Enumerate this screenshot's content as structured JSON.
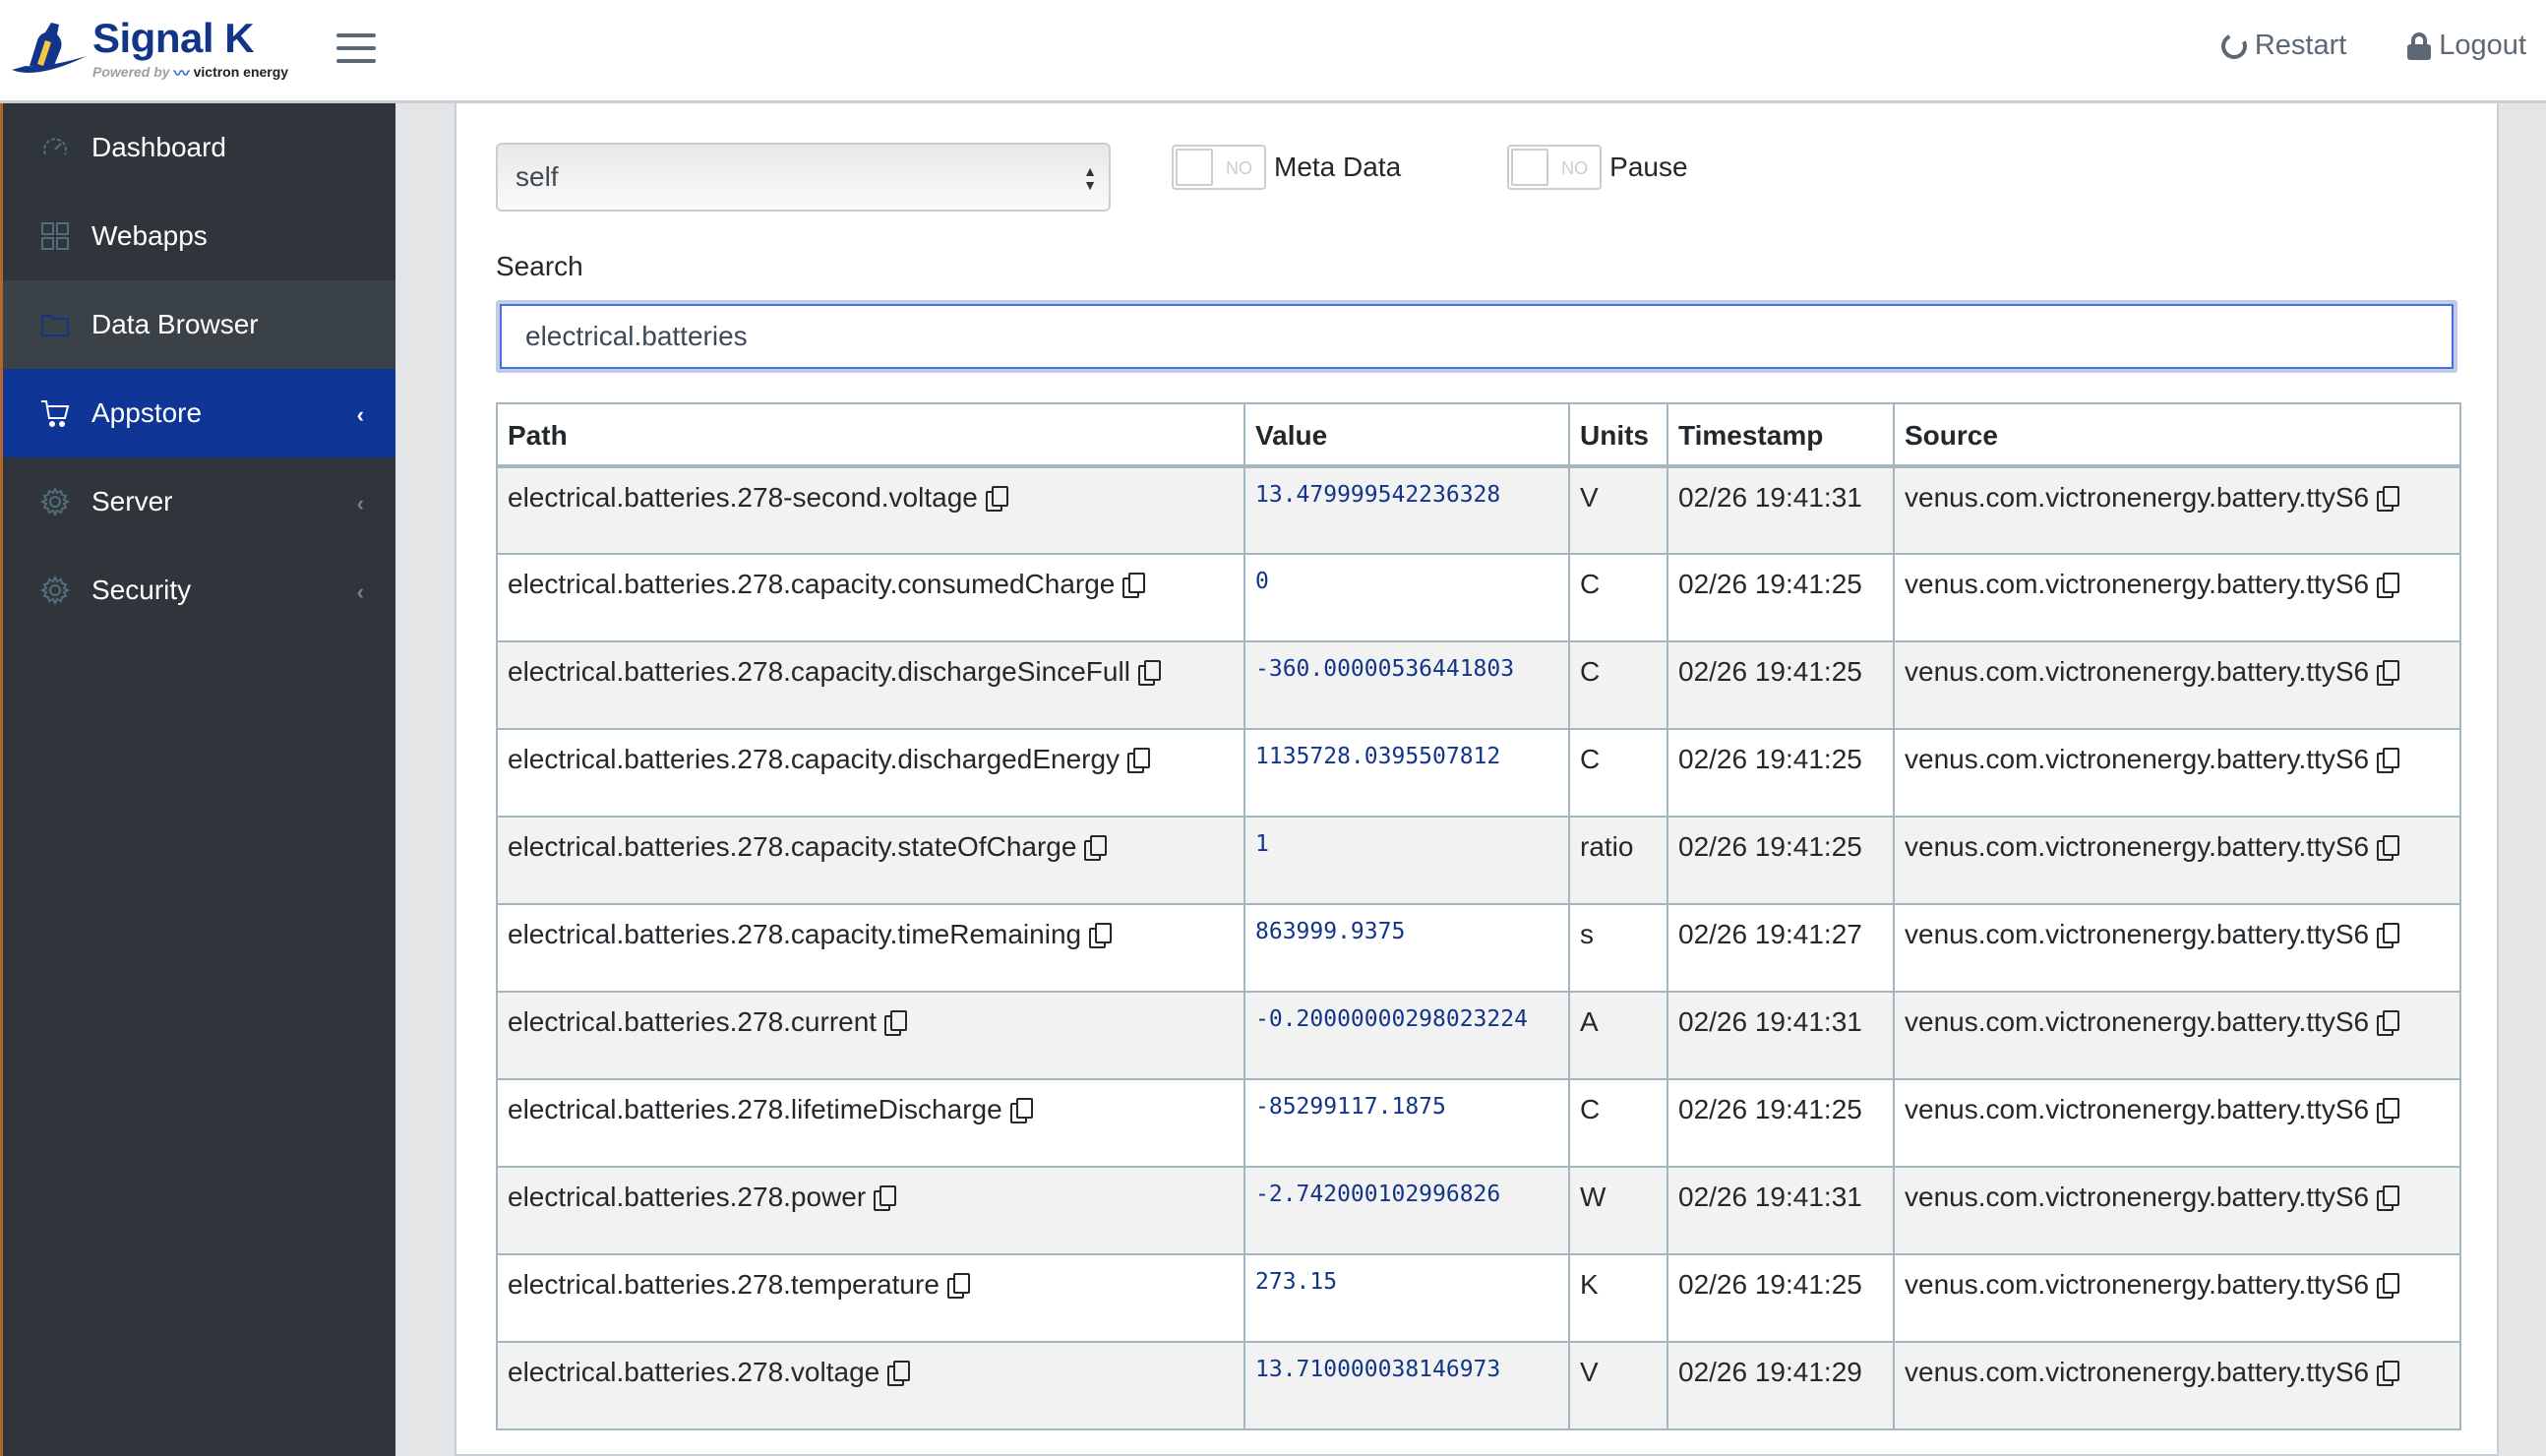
{
  "header": {
    "brand_title": "Signal K",
    "brand_powered_by": "Powered by",
    "brand_partner": "victron energy",
    "restart_label": "Restart",
    "logout_label": "Logout"
  },
  "sidebar": {
    "items": [
      {
        "label": "Dashboard",
        "icon": "speedometer-icon"
      },
      {
        "label": "Webapps",
        "icon": "grid-icon"
      },
      {
        "label": "Data Browser",
        "icon": "folder-icon",
        "active": true
      },
      {
        "label": "Appstore",
        "icon": "cart-icon",
        "open": true,
        "chevron": "‹"
      },
      {
        "label": "Server",
        "icon": "gear-icon",
        "chevron": "‹"
      },
      {
        "label": "Security",
        "icon": "gear-icon",
        "chevron": "‹"
      }
    ]
  },
  "controls": {
    "context_select_value": "self",
    "meta_data": {
      "label": "Meta Data",
      "state": "NO"
    },
    "pause": {
      "label": "Pause",
      "state": "NO"
    }
  },
  "search": {
    "label": "Search",
    "value": "electrical.batteries"
  },
  "table": {
    "columns": [
      "Path",
      "Value",
      "Units",
      "Timestamp",
      "Source"
    ],
    "rows": [
      {
        "path": "electrical.batteries.278-second.voltage",
        "value": "13.479999542236328",
        "units": "V",
        "timestamp": "02/26 19:41:31",
        "source": "venus.com.victronenergy.battery.ttyS6"
      },
      {
        "path": "electrical.batteries.278.capacity.consumedCharge",
        "value": "0",
        "units": "C",
        "timestamp": "02/26 19:41:25",
        "source": "venus.com.victronenergy.battery.ttyS6"
      },
      {
        "path": "electrical.batteries.278.capacity.dischargeSinceFull",
        "value": "-360.00000536441803",
        "units": "C",
        "timestamp": "02/26 19:41:25",
        "source": "venus.com.victronenergy.battery.ttyS6"
      },
      {
        "path": "electrical.batteries.278.capacity.dischargedEnergy",
        "value": "1135728.0395507812",
        "units": "C",
        "timestamp": "02/26 19:41:25",
        "source": "venus.com.victronenergy.battery.ttyS6"
      },
      {
        "path": "electrical.batteries.278.capacity.stateOfCharge",
        "value": "1",
        "units": "ratio",
        "timestamp": "02/26 19:41:25",
        "source": "venus.com.victronenergy.battery.ttyS6"
      },
      {
        "path": "electrical.batteries.278.capacity.timeRemaining",
        "value": "863999.9375",
        "units": "s",
        "timestamp": "02/26 19:41:27",
        "source": "venus.com.victronenergy.battery.ttyS6"
      },
      {
        "path": "electrical.batteries.278.current",
        "value": "-0.20000000298023224",
        "units": "A",
        "timestamp": "02/26 19:41:31",
        "source": "venus.com.victronenergy.battery.ttyS6"
      },
      {
        "path": "electrical.batteries.278.lifetimeDischarge",
        "value": "-85299117.1875",
        "units": "C",
        "timestamp": "02/26 19:41:25",
        "source": "venus.com.victronenergy.battery.ttyS6"
      },
      {
        "path": "electrical.batteries.278.power",
        "value": "-2.742000102996826",
        "units": "W",
        "timestamp": "02/26 19:41:31",
        "source": "venus.com.victronenergy.battery.ttyS6"
      },
      {
        "path": "electrical.batteries.278.temperature",
        "value": "273.15",
        "units": "K",
        "timestamp": "02/26 19:41:25",
        "source": "venus.com.victronenergy.battery.ttyS6"
      },
      {
        "path": "electrical.batteries.278.voltage",
        "value": "13.710000038146973",
        "units": "V",
        "timestamp": "02/26 19:41:29",
        "source": "venus.com.victronenergy.battery.ttyS6"
      }
    ]
  },
  "colors": {
    "brand_blue": "#12358a",
    "sidebar_bg": "#2f353a",
    "sidebar_open": "#0f3697",
    "value_text": "#12358a",
    "border": "#a4b7c1"
  }
}
